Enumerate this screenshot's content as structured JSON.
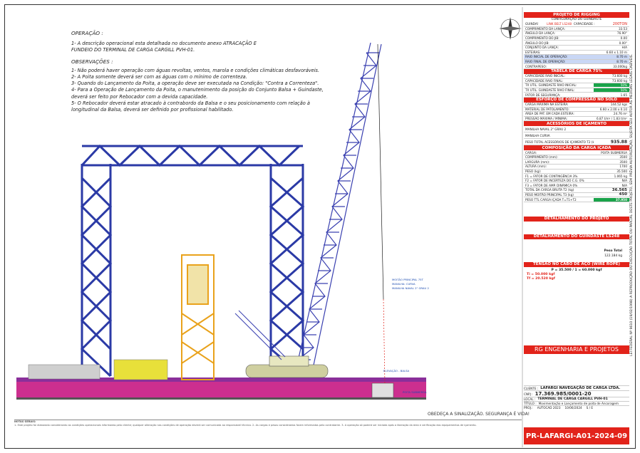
{
  "operation": {
    "heading": "OPERAÇÃO :",
    "item1": "1- A descrição operacional esta detalhada no documento anexo ATRACAÇÃO E\nFUNDEIO DO TERMINAL DE CARGA CARGILL PVH-01.",
    "obs_heading": "OBSERVAÇÕES :",
    "obs": [
      "1- Não poderá haver operação com águas revoltas, ventos, marola e condições climáticas desfavoráveis.",
      "2- A Poita somente deverá ser com as águas com o mínimo de correnteza.",
      "3- Quando do Lançamento da Poita, a operação deve ser executada na Condição: \"Contra a Correnteza\".",
      "4- Para a Operação de Lançamento da Poita, o manutenimento da posição do Conjunto Balsa + Guindaste,\ndeverá ser feito por Rebocador com a devida capacidade.",
      "5- O Rebocador deverá estar atracado à contrabordo da Balsa e o seu posicionamento com relação à\nlongitudinal da Balsa, deverá ser definido por profissional habilitado."
    ]
  },
  "title_block": {
    "header": "PROJETO DE RIGGING",
    "sub": "CONFIGURAÇÃO DO GUINDASTE",
    "crane_label": "GUINDASTE:",
    "crane_model": "LINK BELT LS248",
    "capacity_label": "CAPACIDADE :",
    "capacity": "200TON",
    "params": [
      {
        "k": "COMPRIMENTO DA LANÇA:",
        "v": "33.53"
      },
      {
        "k": "ÂNGULO DA LANÇA:",
        "v": "76.90°"
      },
      {
        "k": "COMPRIMENTO DO JIB:",
        "v": "0.00"
      },
      {
        "k": "ÂNGULO DO JIB:",
        "v": "0.00°"
      },
      {
        "k": "CONJUNTO DA LANÇA:",
        "v": "H/A"
      },
      {
        "k": "ESTEIRAS:",
        "v": "6.60 x 1.10 m"
      },
      {
        "k": "RAIO INICIAL DE OPERAÇÃO:",
        "v": "8.70 m"
      },
      {
        "k": "RAIO FINAL DE OPERAÇÃO:",
        "v": "8.70 m"
      },
      {
        "k": "CONTRAPESO:",
        "v": "33.000kg"
      }
    ],
    "load_table_header": "TABELA DE CARGA 75%",
    "load_table": [
      {
        "k": "CAPACIDADE RAIO INICIAL:",
        "v": "73.600 kg"
      },
      {
        "k": "CAPACIDADE RAIO FINAL:",
        "v": "73.600 kg"
      },
      {
        "k": "TX UTIL. GUINDASTE RAIO INICIAL:",
        "v": "50%"
      },
      {
        "k": "TX UTIL. GUINDASTE RAIO FINAL:",
        "v": "50%"
      },
      {
        "k": "FATOR DE SEGURANÇA:",
        "v": "1.65"
      }
    ],
    "soil_header": "ESFORÇO DE COMPRESSÃO NO SOLO",
    "soil": [
      {
        "k": "CARGA MÁXIMA NA ESTEIRA:",
        "v": "144.52 kgs"
      },
      {
        "k": "MATERIAL DE PATOLAMENTO:",
        "v": "6.60 x 2.00 x 0.10"
      },
      {
        "k": "ÁREA DE PAT. EM CADA ESTEIRA:",
        "v": "24.76 m²"
      },
      {
        "k": "PRESSÃO MÁXIMA / MÍNIMA:",
        "v": "6.87 t/m² / 1.83 t/m²"
      }
    ],
    "acc_header": "ACESSÓRIOS DE IÇAMENTO",
    "acc_rows": [
      "MANILHA NAVAL 2\" GRAU 2",
      "MANILHA CURVA"
    ],
    "acc_total_label": "PESO TOTAL ACESSÓRIOS DE IÇAMENTO T2 (kg)",
    "acc_total": "935.88",
    "comp_header": "COMPOSIÇÃO DA CARGA IÇADA",
    "comp": [
      {
        "k": "CARGA:",
        "v": "POITA SUBMERSA"
      },
      {
        "k": "COMPRIMENTO (mm):",
        "v": "3500"
      },
      {
        "k": "LARGURA (mm):",
        "v": "3500"
      },
      {
        "k": "ALTURA (mm):",
        "v": "1700"
      },
      {
        "k": "PESO (kg):",
        "v": "35.500"
      },
      {
        "k": "F1 = FATOR DE CONTINGÊNCIA 3%",
        "v": "1.065 kg"
      },
      {
        "k": "F2 = FATOR DE INCERTEZA DO C.G. 0%",
        "v": "N/A"
      },
      {
        "k": "F3 = FATOR DE AMP. DINÂMICA 0%",
        "v": "N/A"
      },
      {
        "k": "TOTAL DA CARGA BRUTA T2 (kg)",
        "v": "36.565"
      },
      {
        "k": "PESO MOITÃO PRINCIPAL T3 (kg)",
        "v": "450"
      },
      {
        "k": "PESO TTL CARGA IÇADA T=T1+T2",
        "v": "37.950"
      }
    ],
    "project_detail_header": "DETALHAMENTO DO PROJETO",
    "crane_detail_header": "DETALHAMENTO DO GUINDASTE LS248",
    "rope_header": "TENSÃO NO CABO DE AÇO (WIRE ROPE)",
    "rope": [
      "P = 35.500 / 1 = 60.000 kgf",
      "Ti = 50.000 kgf",
      "Tf = 20.520 kgf"
    ],
    "weight_total": "Peso Total",
    "weight_value": "122.184 kg"
  },
  "company": {
    "name": "RG ENGENHARIA E PROJETOS",
    "client_label": "CLIENTE :",
    "client": "LAFARGI NAVEGAÇÃO DE CARGA LTDA.",
    "cnpj_label": "CNPJ :",
    "cnpj": "17.369.985/0001-20",
    "local_label": "LOCAL :",
    "local": "TERMINAL DE CARGA CARGILL PVH-01",
    "title_label": "TÍTULO :",
    "title": "Movimentação e Lançamento de poita de Ancoragem",
    "project_label": "PROJ.:",
    "project": "AUTOCAD 2023",
    "date": "10/06/2024",
    "scale": "S / E",
    "drawing_number": "PR-LAFARGI-A01-2024-09"
  },
  "labels": {
    "boom_tip": "MOITÃO PRINCIPAL 75T",
    "sling": "MANILHA: CURVA",
    "shackle": "MANILHA NAVAL 2\" GRAU 2",
    "elev": "ELEVAÇÃO - BALSA",
    "poita": "POITA SUBMERSA"
  },
  "side_text": "LEI FEDERAL Nº 9610 (19/02/1998) A REPRODUÇÃO OU EXECUÇÃO TOTAL OU PARCIAL DESTE PROJETO, SEM PRÉVIA AUTORIZAÇÃO, SUJEITA SEU AUTOR ÀS MEDIDAS LEGAIS CABÍVEIS.",
  "footer_msg": "OBEDEÇA A SINALIZAÇÃO.  SEGURANÇA É VIDA!",
  "notes_heading": "NOTAS GERAIS:",
  "notes_text": "1- Este projeto foi elaborado considerando as condições operacionais informadas pelo cliente; qualquer alteração nas condições de operação deverá ser comunicada ao responsável técnico. 2- As cargas e pesos considerados foram informados pelo contratante. 3- A operação só poderá ser iniciada após a liberação da área e verificação dos equipamentos de içamento.",
  "colors": {
    "accent": "#e2231a",
    "steel": "#2b3aa6",
    "deck": "#cc2f8f",
    "boom": "#3a40b0",
    "green": "#1aa34a"
  }
}
